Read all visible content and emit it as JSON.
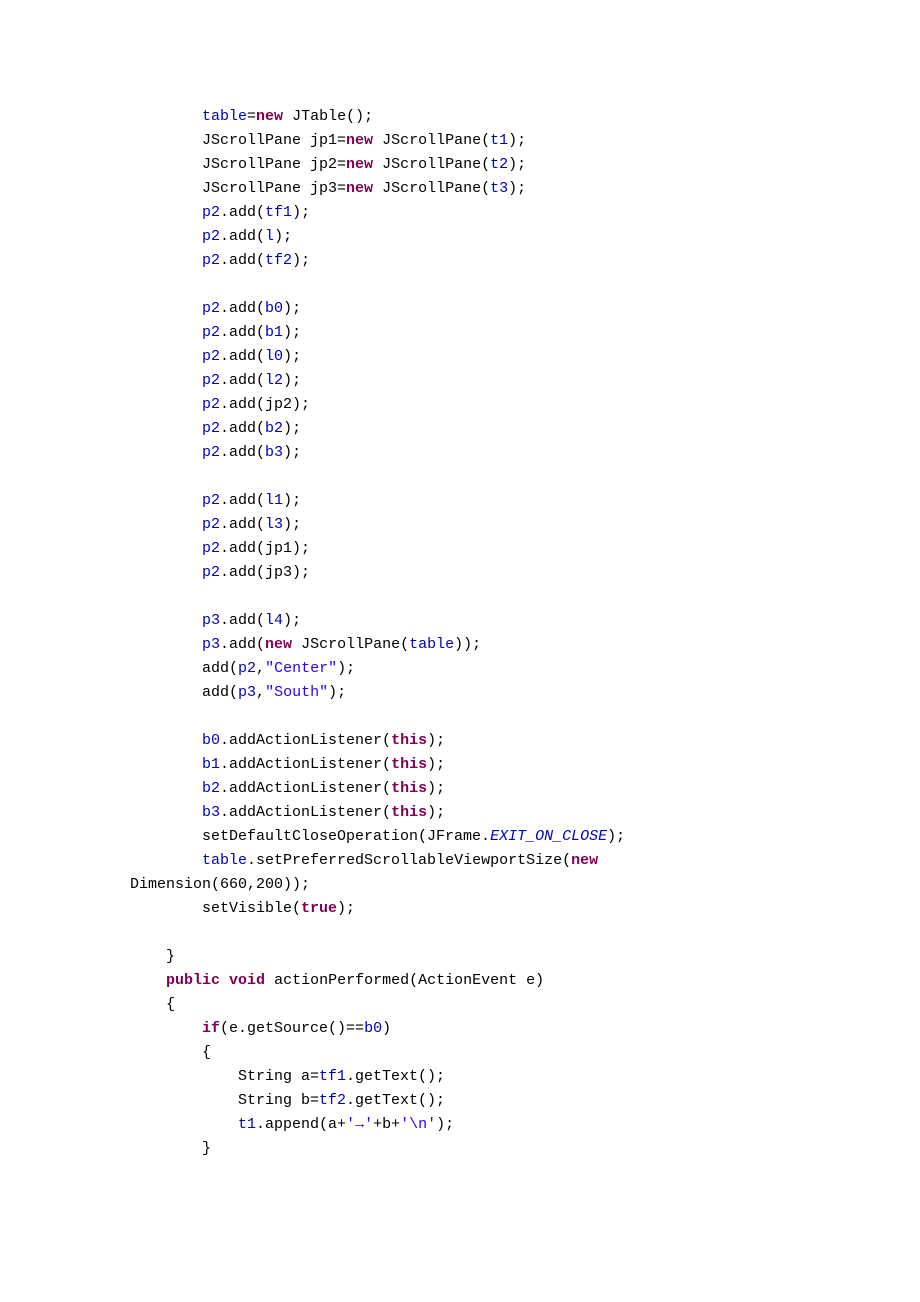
{
  "code": {
    "lines": [
      [
        {
          "t": "        ",
          "c": ""
        },
        {
          "t": "table",
          "c": "fld"
        },
        {
          "t": "=",
          "c": ""
        },
        {
          "t": "new",
          "c": "kw"
        },
        {
          "t": " JTable();",
          "c": ""
        }
      ],
      [
        {
          "t": "        JScrollPane jp1=",
          "c": ""
        },
        {
          "t": "new",
          "c": "kw"
        },
        {
          "t": " JScrollPane(",
          "c": ""
        },
        {
          "t": "t1",
          "c": "fld"
        },
        {
          "t": ");",
          "c": ""
        }
      ],
      [
        {
          "t": "        JScrollPane jp2=",
          "c": ""
        },
        {
          "t": "new",
          "c": "kw"
        },
        {
          "t": " JScrollPane(",
          "c": ""
        },
        {
          "t": "t2",
          "c": "fld"
        },
        {
          "t": ");",
          "c": ""
        }
      ],
      [
        {
          "t": "        JScrollPane jp3=",
          "c": ""
        },
        {
          "t": "new",
          "c": "kw"
        },
        {
          "t": " JScrollPane(",
          "c": ""
        },
        {
          "t": "t3",
          "c": "fld"
        },
        {
          "t": ");",
          "c": ""
        }
      ],
      [
        {
          "t": "        ",
          "c": ""
        },
        {
          "t": "p2",
          "c": "fld"
        },
        {
          "t": ".add(",
          "c": ""
        },
        {
          "t": "tf1",
          "c": "fld"
        },
        {
          "t": ");",
          "c": ""
        }
      ],
      [
        {
          "t": "        ",
          "c": ""
        },
        {
          "t": "p2",
          "c": "fld"
        },
        {
          "t": ".add(",
          "c": ""
        },
        {
          "t": "l",
          "c": "fld"
        },
        {
          "t": ");",
          "c": ""
        }
      ],
      [
        {
          "t": "        ",
          "c": ""
        },
        {
          "t": "p2",
          "c": "fld"
        },
        {
          "t": ".add(",
          "c": ""
        },
        {
          "t": "tf2",
          "c": "fld"
        },
        {
          "t": ");",
          "c": ""
        }
      ],
      [
        {
          "t": "",
          "c": ""
        }
      ],
      [
        {
          "t": "        ",
          "c": ""
        },
        {
          "t": "p2",
          "c": "fld"
        },
        {
          "t": ".add(",
          "c": ""
        },
        {
          "t": "b0",
          "c": "fld"
        },
        {
          "t": ");",
          "c": ""
        }
      ],
      [
        {
          "t": "        ",
          "c": ""
        },
        {
          "t": "p2",
          "c": "fld"
        },
        {
          "t": ".add(",
          "c": ""
        },
        {
          "t": "b1",
          "c": "fld"
        },
        {
          "t": ");",
          "c": ""
        }
      ],
      [
        {
          "t": "        ",
          "c": ""
        },
        {
          "t": "p2",
          "c": "fld"
        },
        {
          "t": ".add(",
          "c": ""
        },
        {
          "t": "l0",
          "c": "fld"
        },
        {
          "t": ");",
          "c": ""
        }
      ],
      [
        {
          "t": "        ",
          "c": ""
        },
        {
          "t": "p2",
          "c": "fld"
        },
        {
          "t": ".add(",
          "c": ""
        },
        {
          "t": "l2",
          "c": "fld"
        },
        {
          "t": ");",
          "c": ""
        }
      ],
      [
        {
          "t": "        ",
          "c": ""
        },
        {
          "t": "p2",
          "c": "fld"
        },
        {
          "t": ".add(jp2);",
          "c": ""
        }
      ],
      [
        {
          "t": "        ",
          "c": ""
        },
        {
          "t": "p2",
          "c": "fld"
        },
        {
          "t": ".add(",
          "c": ""
        },
        {
          "t": "b2",
          "c": "fld"
        },
        {
          "t": ");",
          "c": ""
        }
      ],
      [
        {
          "t": "        ",
          "c": ""
        },
        {
          "t": "p2",
          "c": "fld"
        },
        {
          "t": ".add(",
          "c": ""
        },
        {
          "t": "b3",
          "c": "fld"
        },
        {
          "t": ");",
          "c": ""
        }
      ],
      [
        {
          "t": "",
          "c": ""
        }
      ],
      [
        {
          "t": "        ",
          "c": ""
        },
        {
          "t": "p2",
          "c": "fld"
        },
        {
          "t": ".add(",
          "c": ""
        },
        {
          "t": "l1",
          "c": "fld"
        },
        {
          "t": ");",
          "c": ""
        }
      ],
      [
        {
          "t": "        ",
          "c": ""
        },
        {
          "t": "p2",
          "c": "fld"
        },
        {
          "t": ".add(",
          "c": ""
        },
        {
          "t": "l3",
          "c": "fld"
        },
        {
          "t": ");",
          "c": ""
        }
      ],
      [
        {
          "t": "        ",
          "c": ""
        },
        {
          "t": "p2",
          "c": "fld"
        },
        {
          "t": ".add(jp1);",
          "c": ""
        }
      ],
      [
        {
          "t": "        ",
          "c": ""
        },
        {
          "t": "p2",
          "c": "fld"
        },
        {
          "t": ".add(jp3);",
          "c": ""
        }
      ],
      [
        {
          "t": "",
          "c": ""
        }
      ],
      [
        {
          "t": "        ",
          "c": ""
        },
        {
          "t": "p3",
          "c": "fld"
        },
        {
          "t": ".add(",
          "c": ""
        },
        {
          "t": "l4",
          "c": "fld"
        },
        {
          "t": ");",
          "c": ""
        }
      ],
      [
        {
          "t": "        ",
          "c": ""
        },
        {
          "t": "p3",
          "c": "fld"
        },
        {
          "t": ".add(",
          "c": ""
        },
        {
          "t": "new",
          "c": "kw"
        },
        {
          "t": " JScrollPane(",
          "c": ""
        },
        {
          "t": "table",
          "c": "fld"
        },
        {
          "t": "));",
          "c": ""
        }
      ],
      [
        {
          "t": "        add(",
          "c": ""
        },
        {
          "t": "p2",
          "c": "fld"
        },
        {
          "t": ",",
          "c": ""
        },
        {
          "t": "\"Center\"",
          "c": "str"
        },
        {
          "t": ");",
          "c": ""
        }
      ],
      [
        {
          "t": "        add(",
          "c": ""
        },
        {
          "t": "p3",
          "c": "fld"
        },
        {
          "t": ",",
          "c": ""
        },
        {
          "t": "\"South\"",
          "c": "str"
        },
        {
          "t": ");",
          "c": ""
        }
      ],
      [
        {
          "t": "",
          "c": ""
        }
      ],
      [
        {
          "t": "        ",
          "c": ""
        },
        {
          "t": "b0",
          "c": "fld"
        },
        {
          "t": ".addActionListener(",
          "c": ""
        },
        {
          "t": "this",
          "c": "kw"
        },
        {
          "t": ");",
          "c": ""
        }
      ],
      [
        {
          "t": "        ",
          "c": ""
        },
        {
          "t": "b1",
          "c": "fld"
        },
        {
          "t": ".addActionListener(",
          "c": ""
        },
        {
          "t": "this",
          "c": "kw"
        },
        {
          "t": ");",
          "c": ""
        }
      ],
      [
        {
          "t": "        ",
          "c": ""
        },
        {
          "t": "b2",
          "c": "fld"
        },
        {
          "t": ".addActionListener(",
          "c": ""
        },
        {
          "t": "this",
          "c": "kw"
        },
        {
          "t": ");",
          "c": ""
        }
      ],
      [
        {
          "t": "        ",
          "c": ""
        },
        {
          "t": "b3",
          "c": "fld"
        },
        {
          "t": ".addActionListener(",
          "c": ""
        },
        {
          "t": "this",
          "c": "kw"
        },
        {
          "t": ");",
          "c": ""
        }
      ],
      [
        {
          "t": "        setDefaultCloseOperation(JFrame.",
          "c": ""
        },
        {
          "t": "EXIT_ON_CLOSE",
          "c": "stat"
        },
        {
          "t": ");",
          "c": ""
        }
      ],
      [
        {
          "t": "        ",
          "c": ""
        },
        {
          "t": "table",
          "c": "fld"
        },
        {
          "t": ".setPreferredScrollableViewportSize(",
          "c": ""
        },
        {
          "t": "new",
          "c": "kw"
        }
      ],
      [
        {
          "t": "Dimension(660,200));",
          "c": ""
        }
      ],
      [
        {
          "t": "        setVisible(",
          "c": ""
        },
        {
          "t": "true",
          "c": "kw"
        },
        {
          "t": ");",
          "c": ""
        }
      ],
      [
        {
          "t": "",
          "c": ""
        }
      ],
      [
        {
          "t": "    }",
          "c": ""
        }
      ],
      [
        {
          "t": "    ",
          "c": ""
        },
        {
          "t": "public",
          "c": "kw"
        },
        {
          "t": " ",
          "c": ""
        },
        {
          "t": "void",
          "c": "kw"
        },
        {
          "t": " actionPerformed(ActionEvent e)",
          "c": ""
        }
      ],
      [
        {
          "t": "    {",
          "c": ""
        }
      ],
      [
        {
          "t": "        ",
          "c": ""
        },
        {
          "t": "if",
          "c": "kw"
        },
        {
          "t": "(e.getSource()==",
          "c": ""
        },
        {
          "t": "b0",
          "c": "fld"
        },
        {
          "t": ")",
          "c": ""
        }
      ],
      [
        {
          "t": "        {",
          "c": ""
        }
      ],
      [
        {
          "t": "            String a=",
          "c": ""
        },
        {
          "t": "tf1",
          "c": "fld"
        },
        {
          "t": ".getText();",
          "c": ""
        }
      ],
      [
        {
          "t": "            String b=",
          "c": ""
        },
        {
          "t": "tf2",
          "c": "fld"
        },
        {
          "t": ".getText();",
          "c": ""
        }
      ],
      [
        {
          "t": "            ",
          "c": ""
        },
        {
          "t": "t1",
          "c": "fld"
        },
        {
          "t": ".append(a+",
          "c": ""
        },
        {
          "t": "'→'",
          "c": "str"
        },
        {
          "t": "+b+",
          "c": ""
        },
        {
          "t": "'\\n'",
          "c": "str"
        },
        {
          "t": ");",
          "c": ""
        }
      ],
      [
        {
          "t": "        }",
          "c": ""
        }
      ]
    ]
  }
}
